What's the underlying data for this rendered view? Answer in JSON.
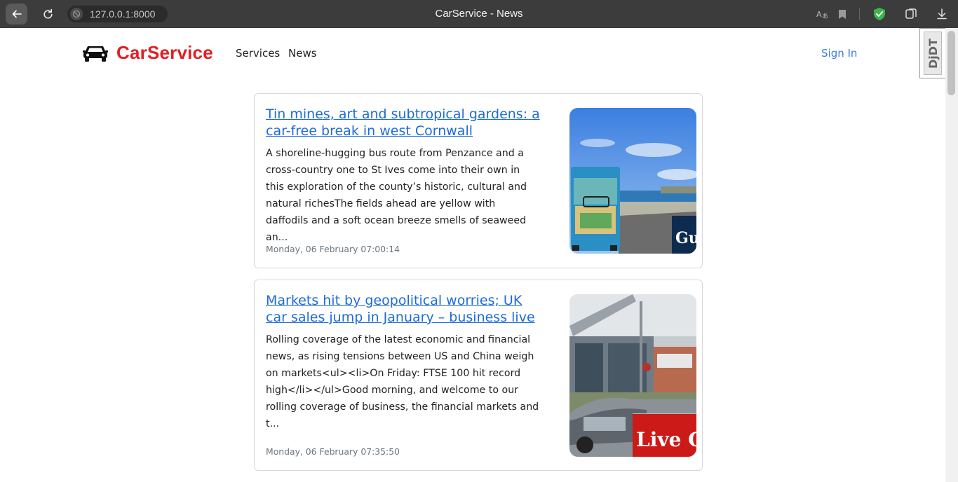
{
  "browser": {
    "url": "127.0.0.1:8000",
    "window_title": "CarService - News"
  },
  "navbar": {
    "brand": "CarService",
    "links": [
      "Services",
      "News"
    ],
    "sign_in": "Sign In"
  },
  "debug_toolbar": {
    "label": "DjDT"
  },
  "articles": [
    {
      "title": "Tin mines, art and subtropical gardens: a car-free break in west Cornwall",
      "description": "A shoreline-hugging bus route from Penzance and a cross-country one to St Ives come into their own in this exploration of the county’s historic, cultural and natural richesThe fields ahead are yellow with daffodils and a soft ocean breeze smells of seaweed an...",
      "date": "Monday, 06 February 07:00:14",
      "image_badge": "Gu"
    },
    {
      "title": "Markets hit by geopolitical worries; UK car sales jump in January – business live",
      "description": "Rolling coverage of the latest economic and financial news, as rising tensions between US and China weigh on markets<ul><li>On Friday: FTSE 100 hit record high</li></ul>Good morning, and welcome to our rolling coverage of business, the financial markets and t...",
      "date": "Monday, 06 February 07:35:50",
      "image_badge": "Live G"
    }
  ],
  "colors": {
    "brand": "#e31e24",
    "link": "#1e6bdc",
    "sign_in": "#3b7dd8"
  }
}
